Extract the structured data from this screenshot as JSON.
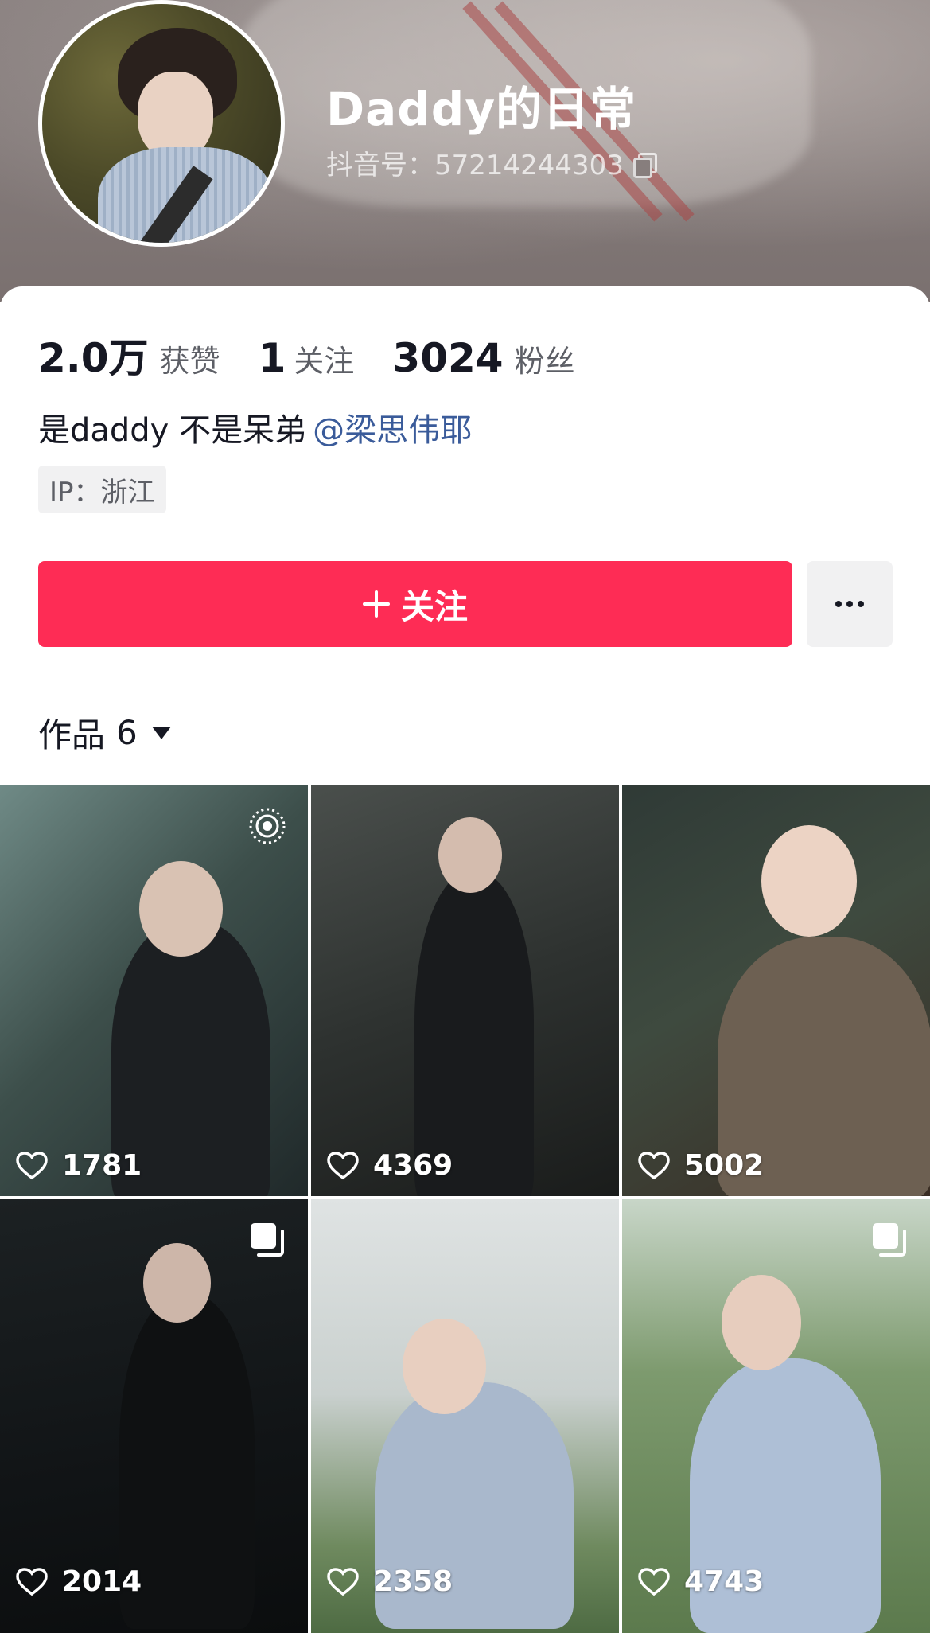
{
  "profile": {
    "nickname": "Daddy的日常",
    "douyin_id": "抖音号：57214244303",
    "stats": [
      {
        "value": "2.0万",
        "label": "获赞"
      },
      {
        "value": "1",
        "label": "关注"
      },
      {
        "value": "3024",
        "label": "粉丝"
      }
    ],
    "bio_text": "是daddy 不是呆弟",
    "bio_mention": "@梁思伟耶",
    "ip": "IP：浙江"
  },
  "actions": {
    "follow_label": "关注",
    "more_icon": "more-dots-icon"
  },
  "works": {
    "label": "作品",
    "count": "6",
    "items": [
      {
        "likes": "1781",
        "badge": "live-photo-icon"
      },
      {
        "likes": "4369",
        "badge": ""
      },
      {
        "likes": "5002",
        "badge": ""
      },
      {
        "likes": "2014",
        "badge": "album-icon"
      },
      {
        "likes": "2358",
        "badge": ""
      },
      {
        "likes": "4743",
        "badge": "album-icon"
      }
    ]
  },
  "colors": {
    "accent": "#fe2c55",
    "mention": "#3a5b9a",
    "text": "#161823",
    "secondary": "#5d5f66"
  }
}
